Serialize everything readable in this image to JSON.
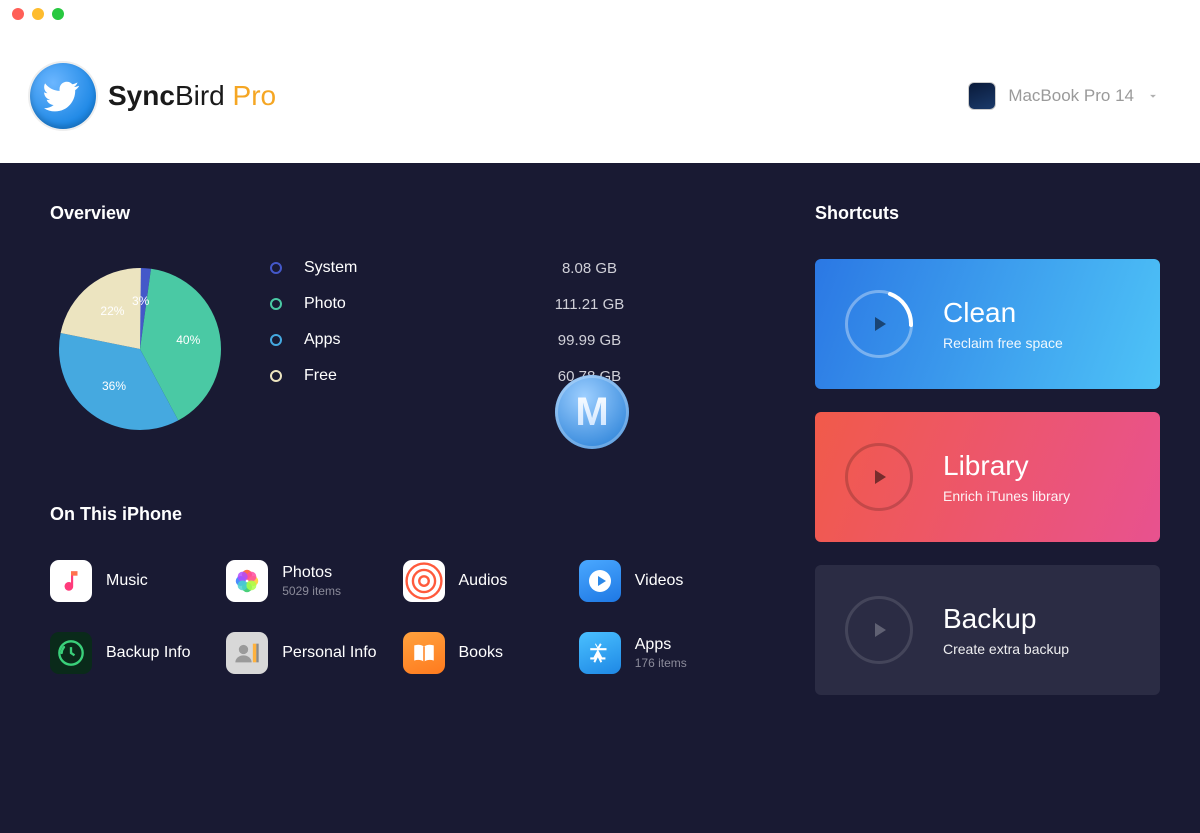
{
  "app": {
    "name_bold": "Sync",
    "name_light": "Bird",
    "name_suffix": " Pro"
  },
  "device": {
    "selected": "MacBook Pro 14"
  },
  "overview": {
    "title": "Overview",
    "legend": [
      {
        "label": "System",
        "value": "8.08 GB",
        "color": "#4458c9"
      },
      {
        "label": "Photo",
        "value": "111.21 GB",
        "color": "#4ac9a4"
      },
      {
        "label": "Apps",
        "value": "99.99 GB",
        "color": "#45a9e0"
      },
      {
        "label": "Free",
        "value": "60.78 GB",
        "color": "#ece4c0"
      }
    ]
  },
  "chart_data": {
    "type": "pie",
    "unit": "percent",
    "slices": [
      {
        "label": "System",
        "value": 3,
        "color": "#4458c9",
        "display": "3%"
      },
      {
        "label": "Photo",
        "value": 40,
        "color": "#4ac9a4",
        "display": "40%"
      },
      {
        "label": "Apps",
        "value": 36,
        "color": "#45a9e0",
        "display": "36%"
      },
      {
        "label": "Free",
        "value": 22,
        "color": "#ece4c0",
        "display": "22%"
      }
    ]
  },
  "iphone": {
    "title": "On This iPhone",
    "cats": [
      {
        "label": "Music",
        "sub": ""
      },
      {
        "label": "Photos",
        "sub": "5029 items"
      },
      {
        "label": "Audios",
        "sub": ""
      },
      {
        "label": "Videos",
        "sub": ""
      },
      {
        "label": "Backup Info",
        "sub": ""
      },
      {
        "label": "Personal Info",
        "sub": ""
      },
      {
        "label": "Books",
        "sub": ""
      },
      {
        "label": "Apps",
        "sub": "176 items"
      }
    ]
  },
  "shortcuts": {
    "title": "Shortcuts",
    "items": [
      {
        "title": "Clean",
        "sub": "Reclaim free space"
      },
      {
        "title": "Library",
        "sub": "Enrich iTunes library"
      },
      {
        "title": "Backup",
        "sub": "Create extra backup"
      }
    ]
  }
}
